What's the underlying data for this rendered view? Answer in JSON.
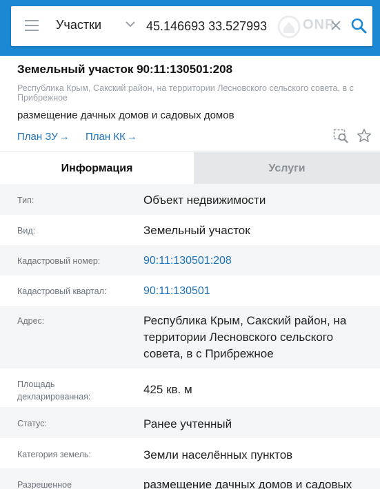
{
  "search": {
    "category": "Участки",
    "query": "45.146693 33.527993",
    "watermark": "ONR"
  },
  "icons": {
    "menu": "menu-icon",
    "chevron": "chevron-down-icon",
    "clear": "close-icon",
    "search": "search-icon",
    "map_search": "map-search-icon",
    "favorite": "star-icon"
  },
  "colors": {
    "header": "#1a88d4",
    "link": "#1f72b8",
    "inactive_tab": "#e4e8eb"
  },
  "parcel": {
    "title": "Земельный участок 90:11:130501:208",
    "address": "Республика Крым, Сакский район, на территории Лесновского сельского совета, в с Прибрежное",
    "use": "размещение дачных домов и садовых домов",
    "plan_zu": "План ЗУ",
    "plan_kk": "План КК",
    "arrow": "→"
  },
  "tabs": [
    {
      "label": "Информация",
      "active": true
    },
    {
      "label": "Услуги",
      "active": false
    }
  ],
  "rows": [
    {
      "label": "Тип:",
      "value": "Объект недвижимости"
    },
    {
      "label": "Вид:",
      "value": "Земельный участок"
    },
    {
      "label": "Кадастровый номер:",
      "value": "90:11:130501:208"
    },
    {
      "label": "Кадастровый квартал:",
      "value": "90:11:130501"
    },
    {
      "label": "Адрес:",
      "value": "Республика Крым, Сакский район, на территории Лесновского сельского совета, в с Прибрежное"
    },
    {
      "label": "Площадь декларированная:",
      "value": "425 кв. м"
    },
    {
      "label": "Статус:",
      "value": "Ранее учтенный"
    },
    {
      "label": "Категория земель:",
      "value": "Земли населённых пунктов"
    },
    {
      "label": "Разрешенное",
      "value": "размещение дачных домов и садовых"
    }
  ]
}
